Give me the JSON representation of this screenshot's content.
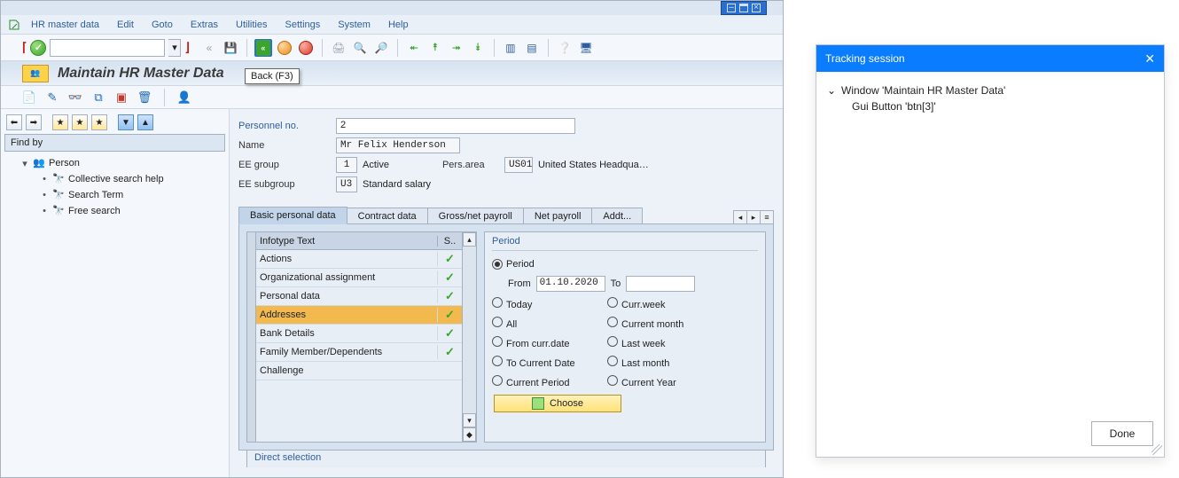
{
  "menu": {
    "items": [
      "HR master data",
      "Edit",
      "Goto",
      "Extras",
      "Utilities",
      "Settings",
      "System",
      "Help"
    ]
  },
  "toolbar": {
    "tooltip": "Back   (F3)"
  },
  "title": "Maintain HR Master Data",
  "findBy": {
    "header": "Find by",
    "root": "Person",
    "items": [
      "Collective search help",
      "Search Term",
      "Free search"
    ]
  },
  "header": {
    "personnel_no_label": "Personnel no.",
    "personnel_no": "2",
    "name_label": "Name",
    "name": "Mr Felix Henderson",
    "ee_group_label": "EE group",
    "ee_group_code": "1",
    "ee_group_text": "Active",
    "pers_area_label": "Pers.area",
    "pers_area_code": "US01",
    "pers_area_text": "United States Headqua…",
    "ee_subgroup_label": "EE subgroup",
    "ee_subgroup_code": "U3",
    "ee_subgroup_text": "Standard salary"
  },
  "tabs": [
    "Basic personal data",
    "Contract data",
    "Gross/net payroll",
    "Net payroll",
    "Addt..."
  ],
  "infotable": {
    "head_main": "Infotype Text",
    "head_s": "S..",
    "rows": [
      {
        "text": "Actions",
        "status": "check",
        "selected": false
      },
      {
        "text": "Organizational assignment",
        "status": "check",
        "selected": false
      },
      {
        "text": "Personal data",
        "status": "check",
        "selected": false
      },
      {
        "text": "Addresses",
        "status": "check",
        "selected": true
      },
      {
        "text": "Bank Details",
        "status": "check",
        "selected": false
      },
      {
        "text": "Family Member/Dependents",
        "status": "check",
        "selected": false
      },
      {
        "text": "Challenge",
        "status": "",
        "selected": false
      }
    ]
  },
  "period": {
    "title": "Period",
    "selected": "Period",
    "from_label": "From",
    "from_value": "01.10.2020",
    "to_label": "To",
    "to_value": "",
    "options_left": [
      "Today",
      "All",
      "From curr.date",
      "To Current Date",
      "Current Period"
    ],
    "options_right": [
      "Curr.week",
      "Current month",
      "Last week",
      "Last month",
      "Current Year"
    ],
    "choose_label": "Choose"
  },
  "direct_selection_label": "Direct selection",
  "tracking": {
    "title": "Tracking session",
    "node1": "Window 'Maintain HR Master Data'",
    "node2": "Gui Button 'btn[3]'",
    "done": "Done"
  }
}
